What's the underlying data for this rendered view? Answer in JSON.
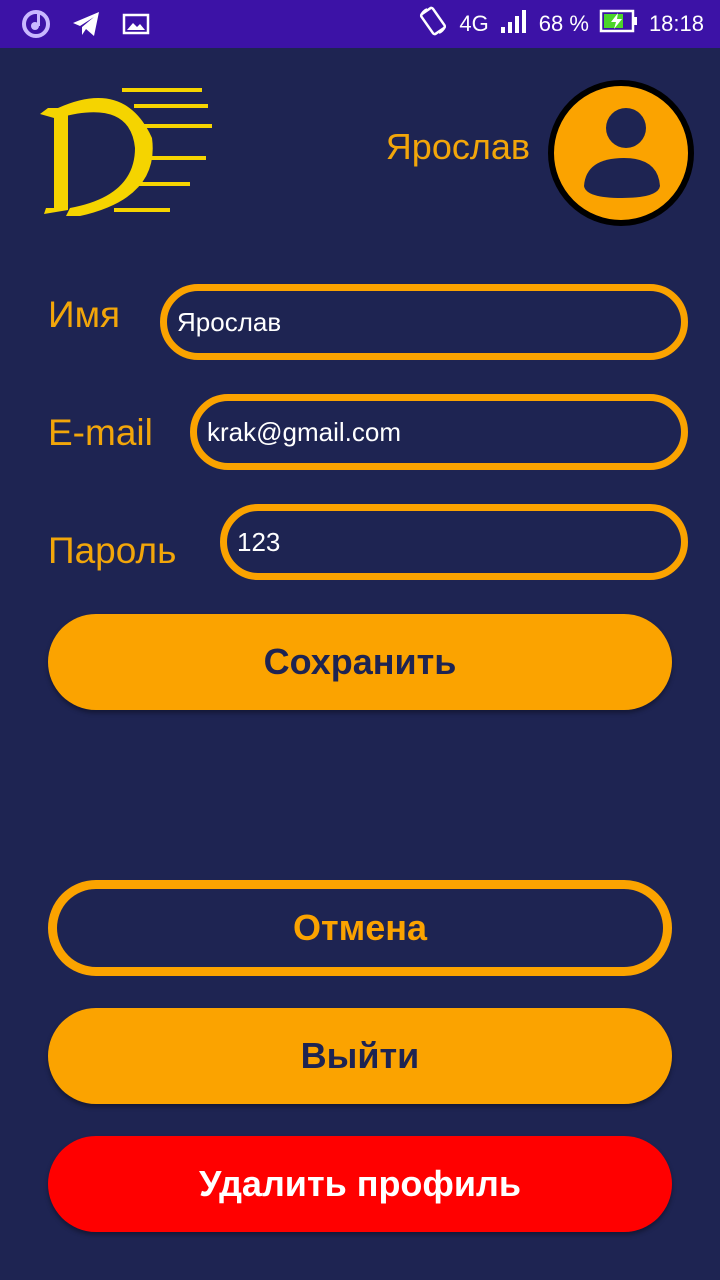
{
  "status_bar": {
    "icons_left": [
      "music-app-icon",
      "telegram-icon",
      "image-icon"
    ],
    "network": "4G",
    "battery": "68 %",
    "time": "18:18"
  },
  "header": {
    "username": "Ярослав",
    "avatar_icon": "user-icon"
  },
  "form": {
    "name_label": "Имя",
    "name_value": "Ярослав",
    "email_label": "E-mail",
    "email_value": "krak@gmail.com",
    "password_label": "Пароль",
    "password_value": "123"
  },
  "buttons": {
    "save": "Сохранить",
    "cancel": "Отмена",
    "logout": "Выйти",
    "delete": "Удалить профиль"
  },
  "colors": {
    "background": "#1e2452",
    "accent": "#fba300",
    "danger": "#ff0000",
    "status_bar": "#3c12a6"
  }
}
